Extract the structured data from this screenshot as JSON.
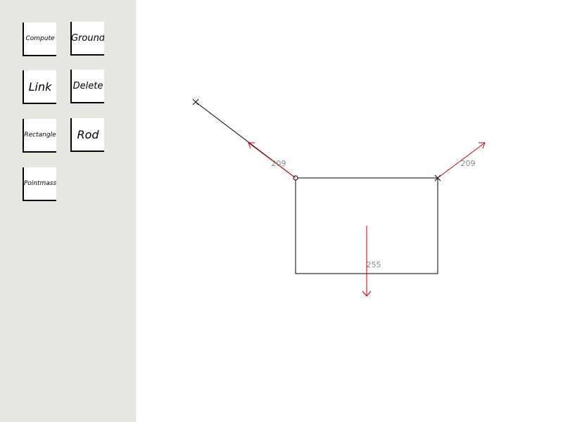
{
  "toolbar": {
    "buttons": {
      "compute": "Compute",
      "ground": "Ground",
      "link": "Link",
      "delete": "Delete",
      "rectangle": "Rectangle",
      "rod": "Rod",
      "pointmass": "Pointmass"
    }
  },
  "canvas": {
    "forces": {
      "left_link": "209",
      "right_link": "209",
      "gravity": "255"
    }
  },
  "colors": {
    "toolbar_bg": "#e8e6e0",
    "force": "#cc0000",
    "structure": "#000000",
    "label": "#8a8a8a"
  }
}
